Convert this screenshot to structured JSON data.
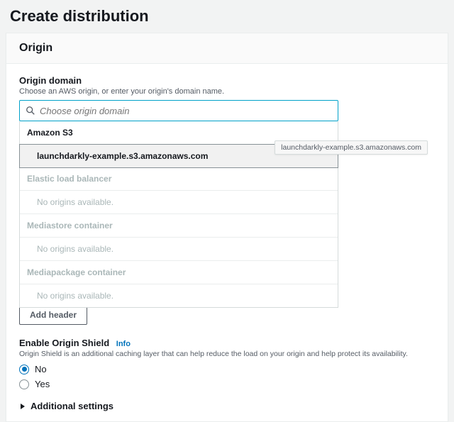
{
  "page_title": "Create distribution",
  "panel": {
    "title": "Origin",
    "origin_domain": {
      "label": "Origin domain",
      "sub": "Choose an AWS origin, or enter your origin's domain name.",
      "placeholder": "Choose origin domain",
      "groups": {
        "s3": {
          "header": "Amazon S3",
          "option": "launchdarkly-example.s3.amazonaws.com"
        },
        "elb": {
          "header": "Elastic load balancer",
          "empty": "No origins available."
        },
        "mediastore": {
          "header": "Mediastore container",
          "empty": "No origins available."
        },
        "mediapackage": {
          "header": "Mediapackage container",
          "empty": "No origins available."
        }
      },
      "tooltip": "launchdarkly-example.s3.amazonaws.com"
    },
    "add_header_label": "Add header",
    "origin_shield": {
      "title": "Enable Origin Shield",
      "info": "Info",
      "desc": "Origin Shield is an additional caching layer that can help reduce the load on your origin and help protect its availability.",
      "no": "No",
      "yes": "Yes"
    },
    "additional_settings": "Additional settings"
  }
}
